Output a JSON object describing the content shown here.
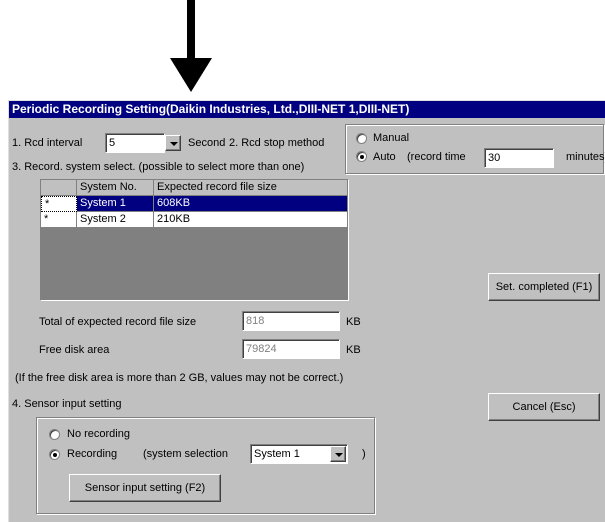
{
  "window": {
    "title": "Periodic Recording Setting(Daikin Industries, Ltd.,DIII-NET 1,DIII-NET)"
  },
  "rcd_interval": {
    "label": "1. Rcd interval",
    "value": "5",
    "unit": "Second"
  },
  "rcd_stop": {
    "label": "2. Rcd stop method",
    "manual_label": "Manual",
    "auto_label": "Auto",
    "selected": "Auto",
    "record_time_label": "(record time",
    "record_time_value": "30",
    "record_time_unit": "minutes)"
  },
  "system_select": {
    "label": "3. Record. system select. (possible to select more than one)",
    "columns": [
      "",
      "System No.",
      "Expected record file size"
    ],
    "rows": [
      {
        "mark": "*",
        "system": "System 1",
        "size": "608KB",
        "selected": true
      },
      {
        "mark": "*",
        "system": "System 2",
        "size": "210KB",
        "selected": false
      }
    ]
  },
  "totals": {
    "total_label": "Total of expected record file size",
    "total_value": "818",
    "total_unit": "KB",
    "free_label": "Free disk area",
    "free_value": "79824",
    "free_unit": "KB",
    "note": "(If the free disk area is more than 2 GB, values may not be correct.)"
  },
  "sensor": {
    "label": "4. Sensor input setting",
    "no_recording_label": "No recording",
    "recording_label": "Recording",
    "selected": "Recording",
    "system_selection_label": "(system selection",
    "system_selection_value": "System 1",
    "close_paren": ")",
    "setting_button": "Sensor input setting (F2)"
  },
  "buttons": {
    "set_completed": "Set. completed (F1)",
    "cancel": "Cancel (Esc)"
  },
  "colors": {
    "titlebar": "#000080",
    "face": "#c0c0c0",
    "selection": "#000080"
  }
}
